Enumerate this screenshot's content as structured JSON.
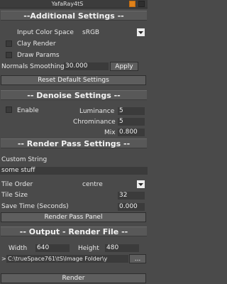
{
  "window": {
    "title": "YafaRay4tS"
  },
  "additional": {
    "header": "--Additional Settings --",
    "input_color_space_label": "Input Color Space",
    "input_color_space_value": "sRGB",
    "clay_render_label": "Clay Render",
    "draw_params_label": "Draw Params",
    "normals_smoothing_label": "Normals Smoothing",
    "normals_smoothing_value": "30.000",
    "apply_label": "Apply",
    "reset_label": "Reset Default Settings"
  },
  "denoise": {
    "header": "-- Denoise Settings --",
    "enable_label": "Enable",
    "luminance_label": "Luminance",
    "luminance_value": "5",
    "chrominance_label": "Chrominance",
    "chrominance_value": "5",
    "mix_label": "Mix",
    "mix_value": "0.800"
  },
  "render_pass": {
    "header": "-- Render Pass Settings --",
    "custom_string_label": "Custom String",
    "custom_string_value": "some stuff",
    "tile_order_label": "Tile Order",
    "tile_order_value": "centre",
    "tile_size_label": "Tile Size",
    "tile_size_value": "32",
    "save_time_label": "Save Time (Seconds)",
    "save_time_value": "0.000",
    "panel_button_label": "Render Pass Panel"
  },
  "output": {
    "header": "-- Output - Render File --",
    "width_label": "Width",
    "width_value": "640",
    "height_label": "Height",
    "height_value": "480",
    "path_prefix": ">",
    "path_value": "C:\\trueSpace761\\tS\\Image Folder\\y",
    "browse_label": "...",
    "render_label": "Render"
  }
}
